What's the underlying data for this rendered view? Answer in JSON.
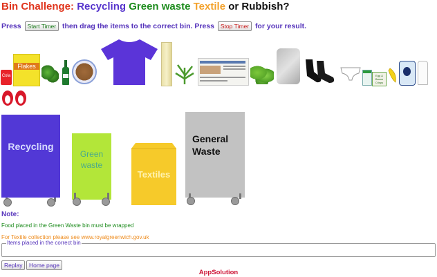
{
  "title": {
    "prefix": "Bin Challenge:",
    "recycling": "Recycling",
    "green": "Green waste",
    "textile": "Textile",
    "or": "or",
    "rubbish": "Rubbish?"
  },
  "instructions": {
    "part1": "Press",
    "start_button": "Start Timer",
    "part2": "then drag the items to the correct bin. Press",
    "stop_button": "Stop Timer",
    "part3": "for your result."
  },
  "items": {
    "cola_label": "Cola",
    "flakes_label": "Flakes",
    "eggbox_label": "Egg & Bacon Crisps"
  },
  "bins": {
    "recycling": "Recycling",
    "green": "Green waste",
    "textiles": "Textiles",
    "general": "General Waste"
  },
  "notes": {
    "title": "Note:",
    "green": "Food placed in the Green Waste bin must be wrapped",
    "textile": "For Textile collection please see www.royalgreenwich.gov.uk"
  },
  "correct_box": {
    "legend": "Items placed in the correct bin"
  },
  "buttons": {
    "replay": "Replay",
    "home": "Home page"
  },
  "footer": "AppSolution",
  "colors": {
    "title_prefix": "#e0341c",
    "recycling": "#5533cc",
    "green": "#1e8c1e",
    "textile": "#f3a22c",
    "recycling_bin": "#5238d6",
    "green_bin": "#b3e639",
    "textile_bin": "#f6ca2a",
    "general_bin": "#c2c2c2"
  }
}
